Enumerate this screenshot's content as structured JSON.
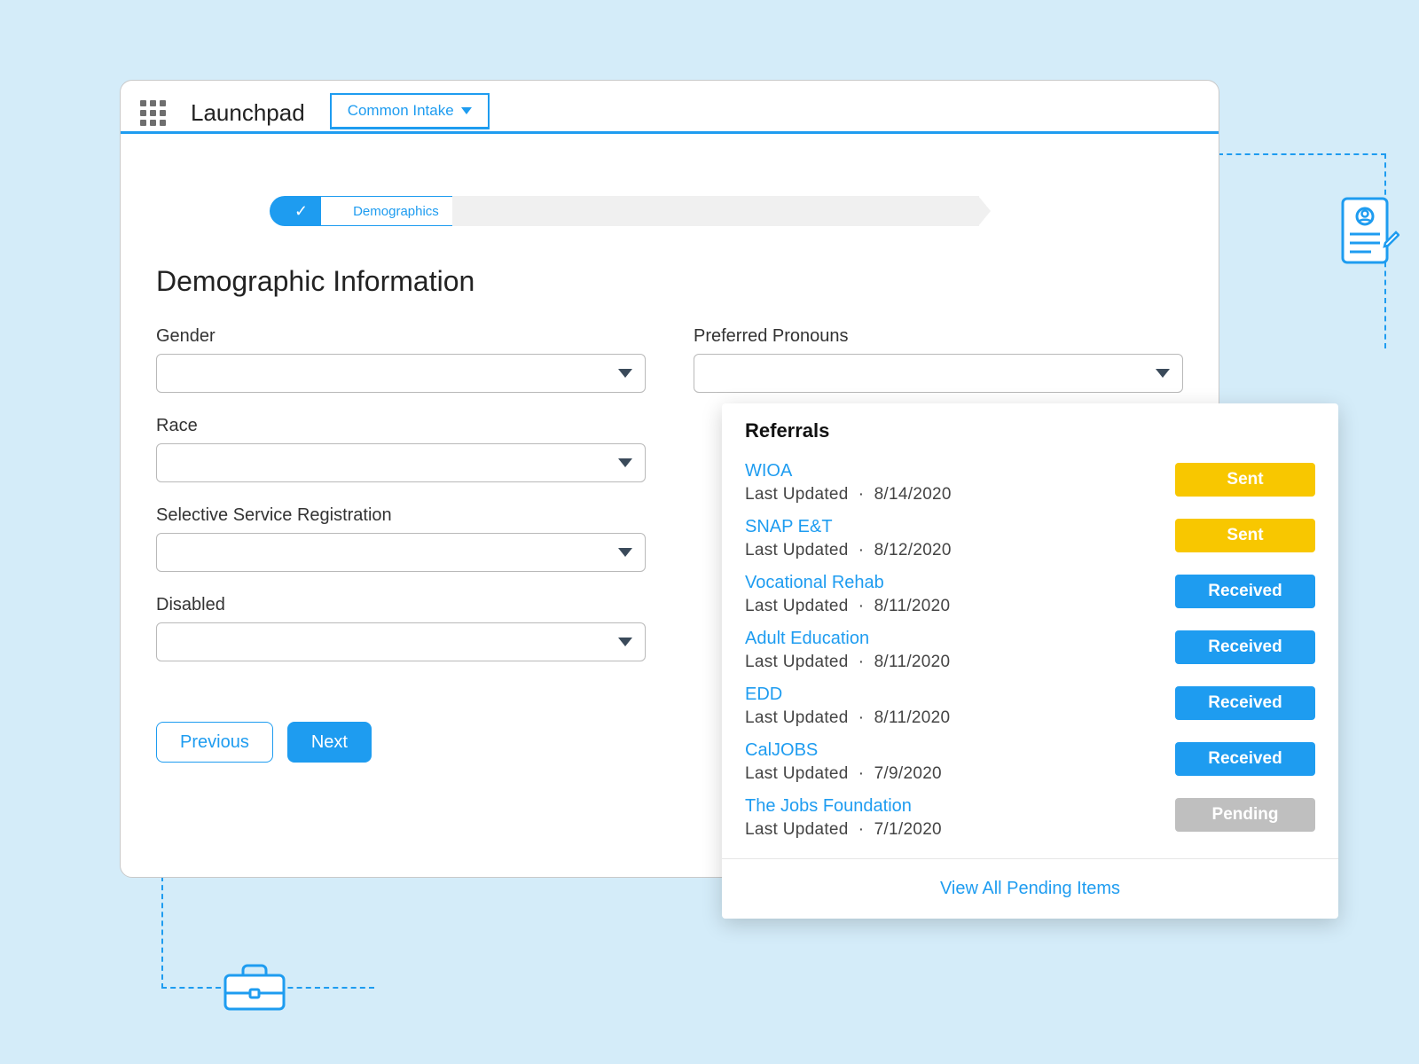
{
  "header": {
    "app_title": "Launchpad",
    "tab_label": "Common Intake"
  },
  "progress": {
    "active_label": "Demographics"
  },
  "page": {
    "title": "Demographic Information"
  },
  "fields": {
    "gender_label": "Gender",
    "pronouns_label": "Preferred Pronouns",
    "race_label": "Race",
    "selective_label": "Selective Service Registration",
    "disabled_label": "Disabled"
  },
  "buttons": {
    "previous": "Previous",
    "next": "Next"
  },
  "referrals": {
    "title": "Referrals",
    "updated_prefix": "Last Updated",
    "footer_link": "View All Pending Items",
    "items": [
      {
        "name": "WIOA",
        "date": "8/14/2020",
        "status": "Sent",
        "status_key": "sent"
      },
      {
        "name": "SNAP E&T",
        "date": "8/12/2020",
        "status": "Sent",
        "status_key": "sent"
      },
      {
        "name": "Vocational Rehab",
        "date": "8/11/2020",
        "status": "Received",
        "status_key": "received"
      },
      {
        "name": "Adult Education",
        "date": "8/11/2020",
        "status": "Received",
        "status_key": "received"
      },
      {
        "name": "EDD",
        "date": "8/11/2020",
        "status": "Received",
        "status_key": "received"
      },
      {
        "name": "CalJOBS",
        "date": "7/9/2020",
        "status": "Received",
        "status_key": "received"
      },
      {
        "name": "The Jobs Foundation",
        "date": "7/1/2020",
        "status": "Pending",
        "status_key": "pending"
      }
    ]
  },
  "colors": {
    "accent": "#1e9cf0",
    "sent": "#f8c700",
    "pending": "#bfbfbf"
  }
}
